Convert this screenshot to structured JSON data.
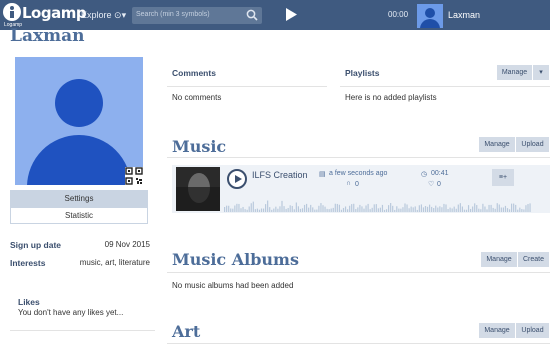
{
  "header": {
    "logo_text": "Logamp",
    "logo_small": "Logamp",
    "explore_label": "Explore",
    "search_placeholder": "Search (min 3 symbols)",
    "time": "00:00",
    "username": "Laxman"
  },
  "profile": {
    "name": "Laxman",
    "settings_label": "Settings",
    "statistic_label": "Statistic",
    "signup_label": "Sign up date",
    "signup_value": "09 Nov 2015",
    "interests_label": "Interests",
    "interests_value": "music, art, literature",
    "likes_title": "Likes",
    "likes_text": "You don't have any likes yet..."
  },
  "comments": {
    "title": "Comments",
    "text": "No comments"
  },
  "playlists": {
    "title": "Playlists",
    "text": "Here is no added playlists",
    "manage_label": "Manage",
    "caret": "▾"
  },
  "music": {
    "title": "Music",
    "manage_label": "Manage",
    "upload_label": "Upload",
    "track": {
      "title": "ILFS Creation",
      "uploaded": "a few seconds ago",
      "duration": "00:41",
      "listens": "0",
      "likes": "0",
      "queue_label": "≡+"
    }
  },
  "albums": {
    "title": "Music Albums",
    "manage_label": "Manage",
    "create_label": "Create",
    "text": "No music albums had been added"
  },
  "art": {
    "title": "Art",
    "manage_label": "Manage",
    "upload_label": "Upload"
  },
  "colors": {
    "topbar": "#3f5a80",
    "accent": "#4d6d99",
    "button_bg": "#d3dbe6",
    "avatar_bg": "#8db0ee",
    "avatar_fg": "#1f52c0"
  }
}
